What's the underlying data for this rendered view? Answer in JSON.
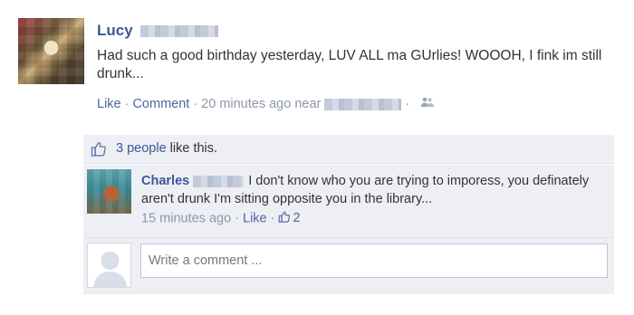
{
  "post": {
    "author": "Lucy",
    "status": "Had such a good birthday yesterday, LUV ALL ma GUrlies! WOOOH, I fink im still drunk...",
    "actions": {
      "like": "Like",
      "comment": "Comment",
      "separator": "·",
      "time": "20 minutes ago",
      "near": "near"
    }
  },
  "likes": {
    "count_text": "3 people",
    "suffix": " like this."
  },
  "comment": {
    "author": "Charles",
    "text": "I don't know who you are trying to imporess, you definately aren't drunk I'm sitting opposite you in the library...",
    "time": "15 minutes ago",
    "like": "Like",
    "like_count": "2",
    "separator": "·"
  },
  "composer": {
    "placeholder": "Write a comment ..."
  },
  "icons": {
    "thumbs_up": "thumbs-up-icon",
    "people": "people-icon",
    "default_avatar": "default-avatar-icon"
  },
  "colors": {
    "link": "#3b5998",
    "meta": "#8d97a8",
    "panel": "#edeff4",
    "text": "#333333"
  }
}
